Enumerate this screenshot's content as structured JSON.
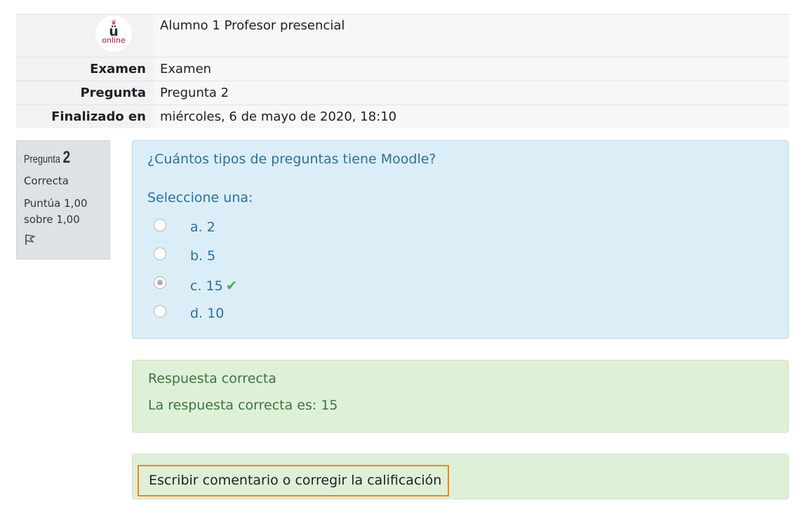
{
  "summary": {
    "user_name": "Alumno 1 Profesor presencial",
    "logo_text": "online",
    "logo_letter": "ü",
    "rows": [
      {
        "label": "Examen",
        "value": "Examen"
      },
      {
        "label": "Pregunta",
        "value": "Pregunta 2"
      },
      {
        "label": "Finalizado en",
        "value": "miércoles, 6 de mayo de 2020, 18:10"
      }
    ]
  },
  "info": {
    "question_label": "Pregunta",
    "question_number": "2",
    "state": "Correcta",
    "grade": "Puntúa 1,00 sobre 1,00",
    "flag_icon": "flag-icon"
  },
  "question": {
    "text": "¿Cuántos tipos de preguntas tiene Moodle?",
    "prompt": "Seleccione una:",
    "answers": [
      {
        "label": "a. 2",
        "checked": false,
        "correct": false
      },
      {
        "label": "b. 5",
        "checked": false,
        "correct": false
      },
      {
        "label": "c. 15",
        "checked": true,
        "correct": true
      },
      {
        "label": "d. 10",
        "checked": false,
        "correct": false
      }
    ]
  },
  "feedback": {
    "title": "Respuesta correcta",
    "right_answer": "La respuesta correcta es: 15"
  },
  "comment": {
    "link": "Escribir comentario o corregir la calificación"
  },
  "colors": {
    "formulation_bg": "#dbeef7",
    "feedback_bg": "#dff0d8",
    "highlight_border": "#f58220",
    "check": "#4caf50"
  }
}
